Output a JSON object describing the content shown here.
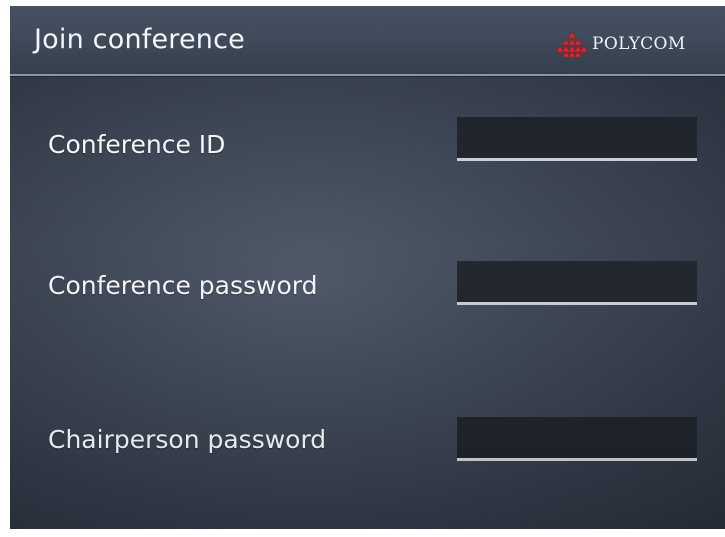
{
  "window": {
    "title": "Join conference",
    "brand_name": "POLYCOM",
    "brand_logo_icon": "polycom-logo-icon",
    "brand_color": "#d8262f"
  },
  "form": {
    "fields": [
      {
        "label": "Conference ID",
        "value": ""
      },
      {
        "label": "Conference password",
        "value": ""
      },
      {
        "label": "Chairperson password",
        "value": ""
      }
    ]
  }
}
